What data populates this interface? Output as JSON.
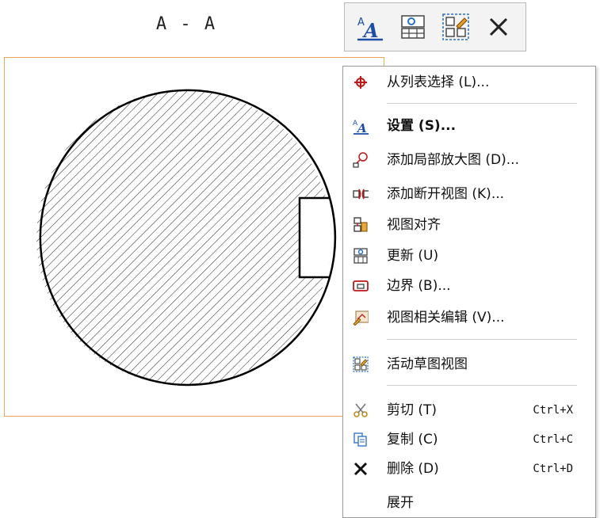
{
  "section_label": "A - A",
  "toolbar": {
    "buttons": [
      {
        "icon": "style-a-icon"
      },
      {
        "icon": "update-view-icon"
      },
      {
        "icon": "active-sketch-view-icon"
      },
      {
        "icon": "delete-x-icon"
      }
    ]
  },
  "menu": {
    "items": [
      {
        "label": "从列表选择 (L)...",
        "icon": "crosshair-target-icon"
      },
      {
        "label": "设置 (S)...",
        "icon": "style-a-icon"
      },
      {
        "label": "添加局部放大图 (D)...",
        "icon": "detail-view-icon"
      },
      {
        "label": "添加断开视图 (K)...",
        "icon": "break-view-icon"
      },
      {
        "label": "视图对齐",
        "icon": "align-view-icon"
      },
      {
        "label": "更新 (U)",
        "icon": "update-view-icon"
      },
      {
        "label": "边界 (B)...",
        "icon": "boundary-icon"
      },
      {
        "label": "视图相关编辑 (V)...",
        "icon": "view-dependent-edit-icon"
      },
      {
        "label": "活动草图视图",
        "icon": "active-sketch-view-icon"
      },
      {
        "label": "剪切 (T)",
        "shortcut": "Ctrl+X",
        "icon": "scissors-icon"
      },
      {
        "label": "复制 (C)",
        "shortcut": "Ctrl+C",
        "icon": "copy-icon"
      },
      {
        "label": "删除 (D)",
        "shortcut": "Ctrl+D",
        "icon": "delete-x-icon"
      },
      {
        "label": "展开",
        "icon": ""
      }
    ]
  }
}
